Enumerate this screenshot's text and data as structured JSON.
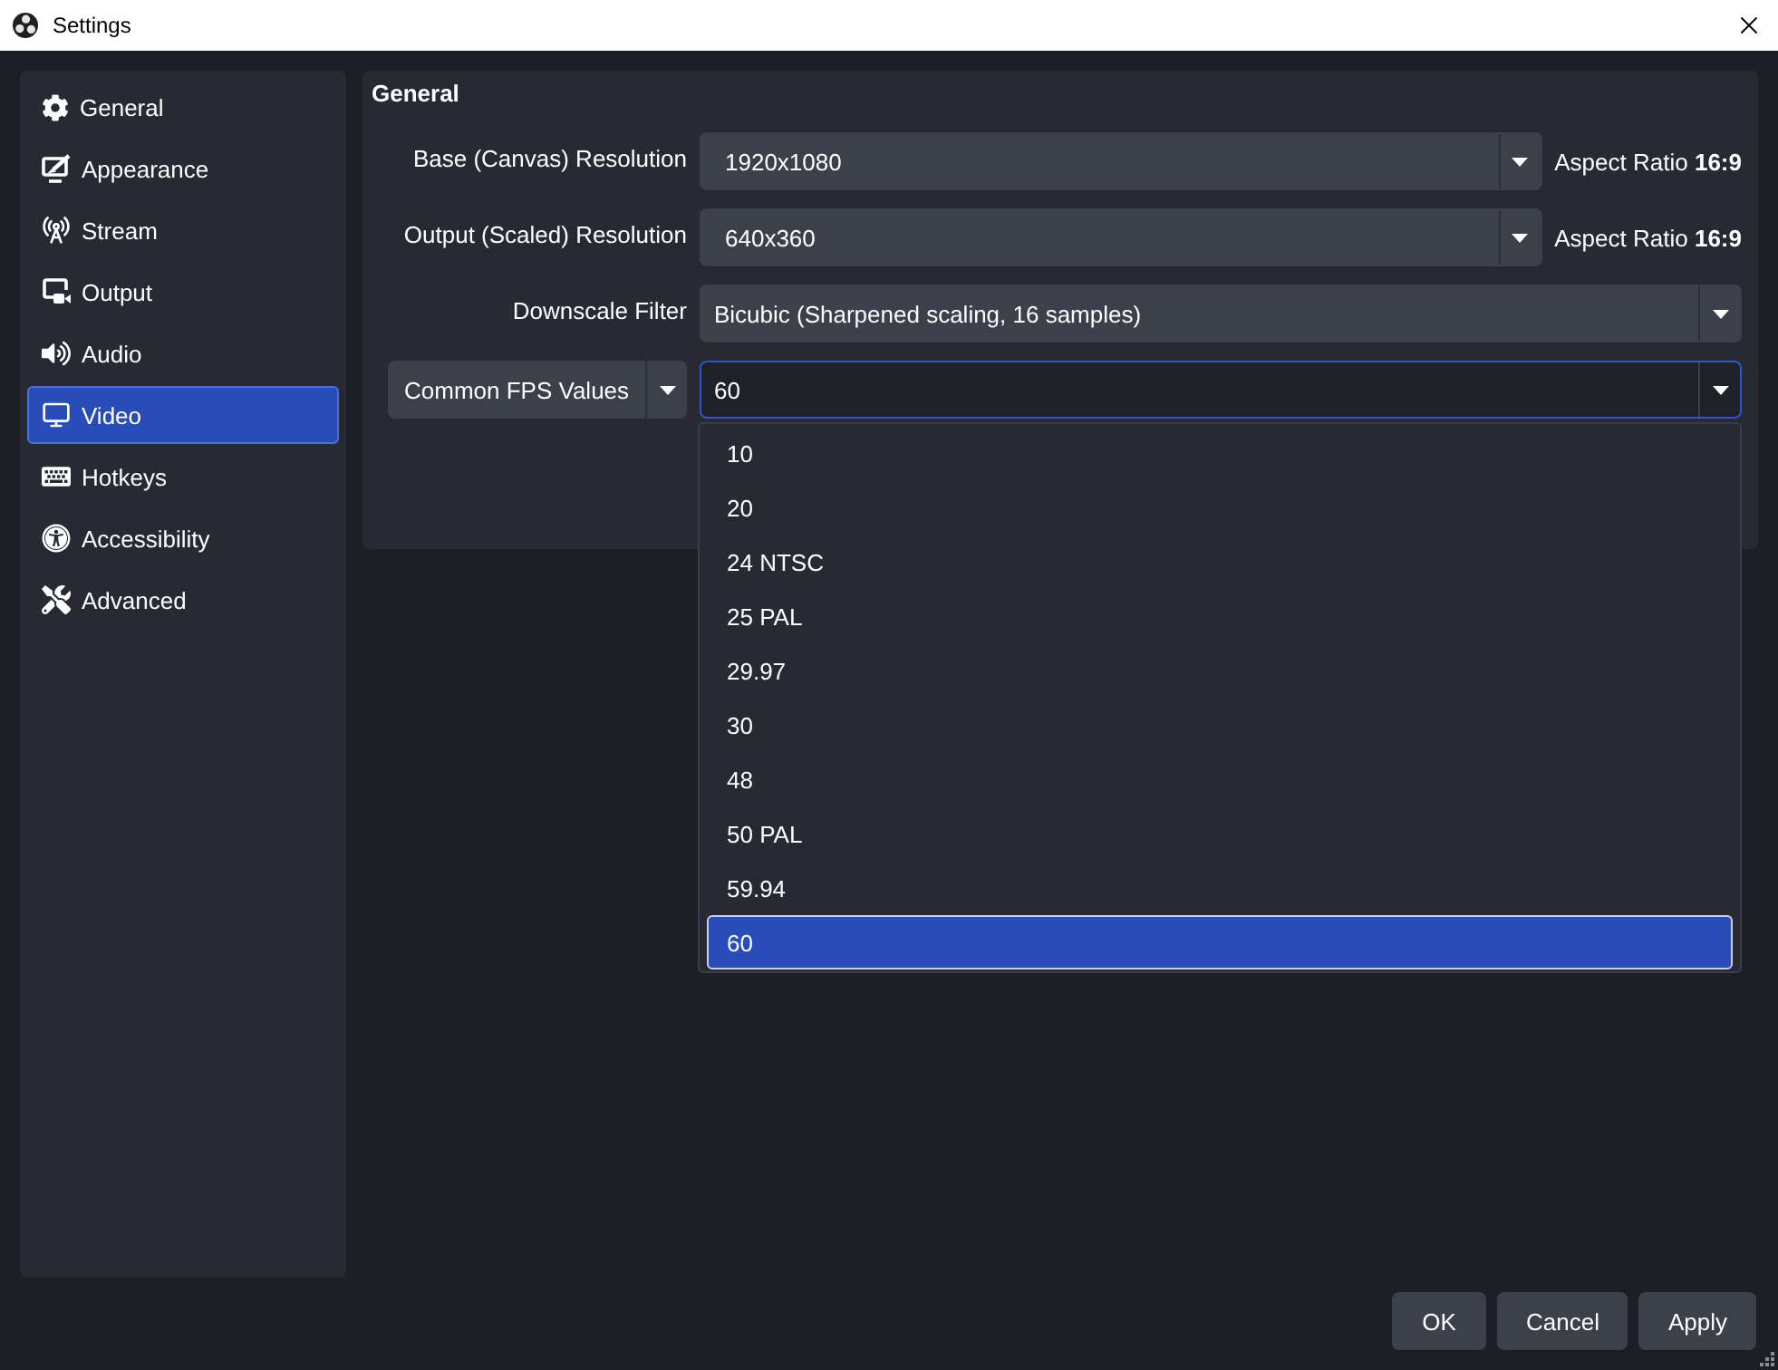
{
  "window": {
    "title": "Settings"
  },
  "sidebar": {
    "items": [
      {
        "label": "General",
        "selected": false
      },
      {
        "label": "Appearance",
        "selected": false
      },
      {
        "label": "Stream",
        "selected": false
      },
      {
        "label": "Output",
        "selected": false
      },
      {
        "label": "Audio",
        "selected": false
      },
      {
        "label": "Video",
        "selected": true
      },
      {
        "label": "Hotkeys",
        "selected": false
      },
      {
        "label": "Accessibility",
        "selected": false
      },
      {
        "label": "Advanced",
        "selected": false
      }
    ]
  },
  "section": {
    "title": "General",
    "rows": [
      {
        "kind": "resolution",
        "label": "Base (Canvas) Resolution",
        "value": "1920x1080",
        "note": "Aspect Ratio **16:9**"
      },
      {
        "kind": "resolution",
        "label": "Output (Scaled) Resolution",
        "value": "640x360",
        "note": "Aspect Ratio **16:9**"
      },
      {
        "kind": "select",
        "label": "Downscale Filter",
        "value": "Bicubic (Sharpened scaling, 16 samples)"
      },
      {
        "kind": "fps",
        "type_label": "Common FPS Values",
        "value": "60",
        "expanded": true,
        "options": [
          {
            "label": "10",
            "selected": false
          },
          {
            "label": "20",
            "selected": false
          },
          {
            "label": "24 NTSC",
            "selected": false
          },
          {
            "label": "25 PAL",
            "selected": false
          },
          {
            "label": "29.97",
            "selected": false
          },
          {
            "label": "30",
            "selected": false
          },
          {
            "label": "48",
            "selected": false
          },
          {
            "label": "50 PAL",
            "selected": false
          },
          {
            "label": "59.94",
            "selected": false
          },
          {
            "label": "60",
            "selected": true
          }
        ]
      }
    ]
  },
  "buttons": [
    {
      "label": "OK"
    },
    {
      "label": "Cancel"
    },
    {
      "label": "Apply"
    }
  ]
}
